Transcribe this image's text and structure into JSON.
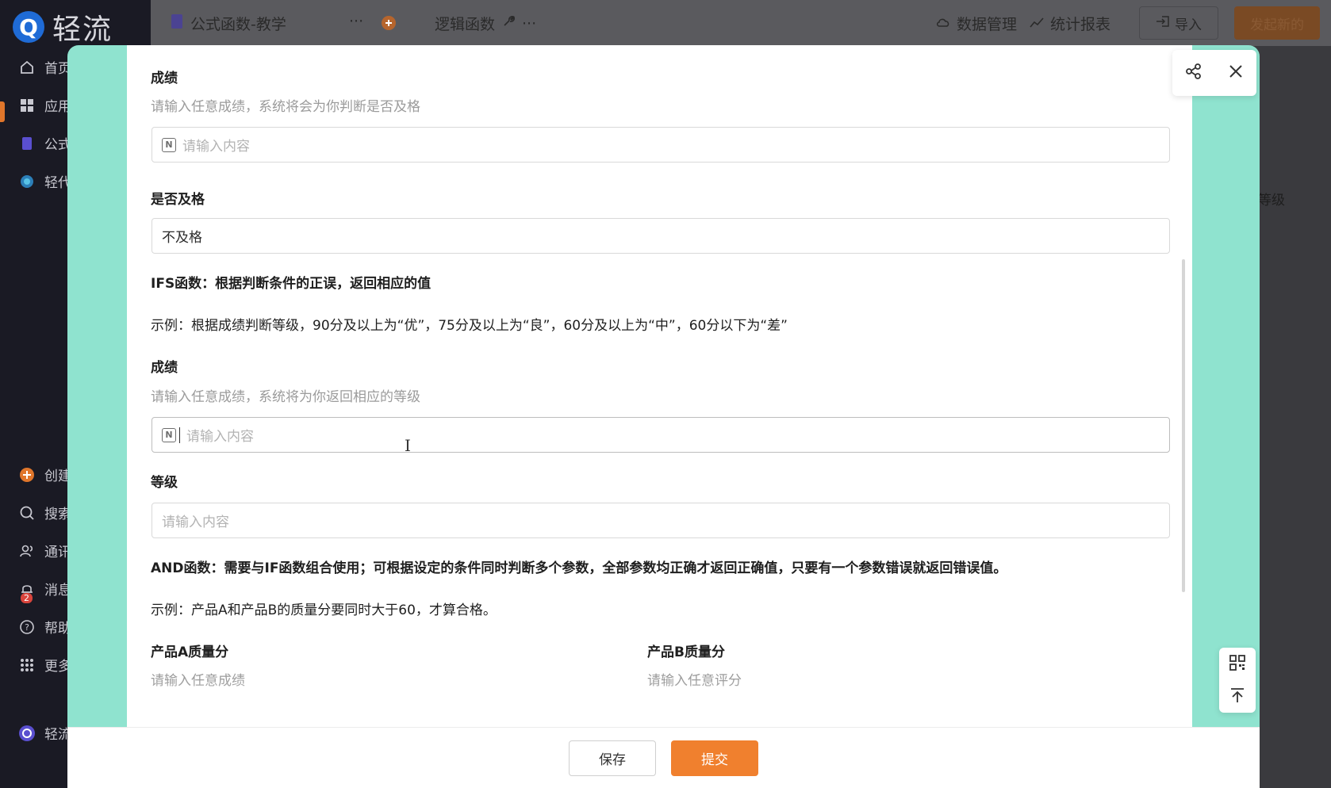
{
  "app": {
    "logo_text": "轻流",
    "logo_letter": "Q",
    "sidebar": {
      "items": [
        {
          "label": "首页",
          "icon": "home-icon"
        },
        {
          "label": "应用",
          "icon": "apps-icon"
        },
        {
          "label": "公式",
          "icon": "form-icon"
        },
        {
          "label": "轻代",
          "icon": "globe-icon"
        }
      ],
      "bottom_items": [
        {
          "label": "创建",
          "icon": "plus-circle-icon"
        },
        {
          "label": "搜索",
          "icon": "search-icon"
        },
        {
          "label": "通讯",
          "icon": "contacts-icon"
        },
        {
          "label": "消息",
          "icon": "bell-icon"
        },
        {
          "label": "帮助",
          "icon": "help-icon"
        },
        {
          "label": "更多",
          "icon": "grid-icon"
        },
        {
          "label": "轻流",
          "icon": "avatar-icon"
        }
      ],
      "message_badge": "2"
    },
    "topbar": {
      "app_title": "公式函数-教学",
      "more": "···",
      "form_title": "逻辑函数",
      "data_mgmt": "数据管理",
      "reports": "统计报表",
      "import": "导入",
      "new_btn": "发起新的"
    },
    "bg_right_text": "等级"
  },
  "form": {
    "f1": {
      "label": "成绩",
      "hint": "请输入任意成绩，系统将会为你判断是否及格",
      "placeholder": "请输入内容"
    },
    "f2": {
      "label": "是否及格",
      "value": "不及格"
    },
    "ifs_title": "IFS函数：根据判断条件的正误，返回相应的值",
    "ifs_example": "示例：根据成绩判断等级，90分及以上为“优”，75分及以上为“良”，60分及以上为“中”，60分以下为“差”",
    "f3": {
      "label": "成绩",
      "hint": "请输入任意成绩，系统将为你返回相应的等级",
      "placeholder": "请输入内容"
    },
    "f4": {
      "label": "等级",
      "placeholder": "请输入内容"
    },
    "and_title": "AND函数：需要与IF函数组合使用；可根据设定的条件同时判断多个参数，全部参数均正确才返回正确值，只要有一个参数错误就返回错误值。",
    "and_example": "示例：产品A和产品B的质量分要同时大于60，才算合格。",
    "f5": {
      "label": "产品A质量分",
      "hint": "请输入任意成绩"
    },
    "f6": {
      "label": "产品B质量分",
      "hint": "请输入任意评分"
    },
    "n_icon_text": "N"
  },
  "footer": {
    "save_label": "保存",
    "submit_label": "提交"
  },
  "colors": {
    "accent": "#f0802e",
    "modal_side": "#8fe3cf",
    "sidebar_bg": "#1a1a24"
  }
}
